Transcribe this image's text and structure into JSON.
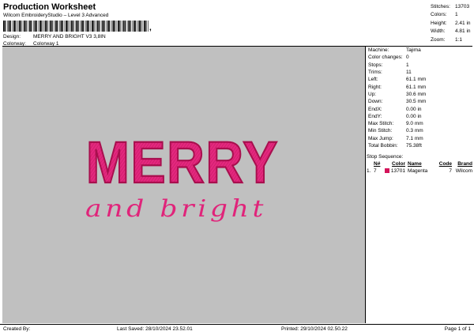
{
  "header": {
    "title": "Production Worksheet",
    "subtitle": "Wilcom EmbroideryStudio – Level 3 Advanced",
    "barcode_suffix": ",",
    "design_label": "Design:",
    "design_value": "MERRY AND BRIGHT V3 3,8IN",
    "colorway_label": "Colorway:",
    "colorway_value": "Colorway 1"
  },
  "top_stats": [
    {
      "label": "Stitches:",
      "value": "13703"
    },
    {
      "label": "Colors:",
      "value": "1"
    },
    {
      "label": "Height:",
      "value": "2.41 in"
    },
    {
      "label": "Width:",
      "value": "4.81 in"
    },
    {
      "label": "Zoom:",
      "value": "1:1"
    }
  ],
  "preview": {
    "line1": "MERRY",
    "line2": "and bright",
    "thread_color": "#e0247a",
    "background": "#c0c0c0"
  },
  "info": [
    {
      "label": "Machine:",
      "value": "Tajima"
    },
    {
      "label": "Color changes:",
      "value": "0"
    },
    {
      "label": "Stops:",
      "value": "1"
    },
    {
      "label": "Trims:",
      "value": "11"
    },
    {
      "label": "Left:",
      "value": "61.1 mm"
    },
    {
      "label": "Right:",
      "value": "61.1 mm"
    },
    {
      "label": "Up:",
      "value": "30.6 mm"
    },
    {
      "label": "Down:",
      "value": "30.5 mm"
    },
    {
      "label": "EndX:",
      "value": "0.00 in"
    },
    {
      "label": "EndY:",
      "value": "0.00 in"
    },
    {
      "label": "Max Stitch:",
      "value": "9.0 mm"
    },
    {
      "label": "Min Stitch:",
      "value": "0.3 mm"
    },
    {
      "label": "Max Jump:",
      "value": "7.1 mm"
    },
    {
      "label": "Total Bobbin:",
      "value": "75.38ft"
    }
  ],
  "stop_sequence": {
    "title": "Stop Sequence:",
    "headers": [
      "N#",
      "",
      "Color",
      "Name",
      "Code",
      "Brand"
    ],
    "rows": [
      {
        "index": "1.",
        "n": "7",
        "swatch": "#d4145a",
        "color": "13701",
        "name": "Magenta",
        "code": "7",
        "brand": "Wilcom"
      }
    ]
  },
  "footer": {
    "created_by": "Created By:",
    "last_saved": "Last Saved: 28/10/2024 23.52.01",
    "printed": "Printed: 29/10/2024 02.50.22",
    "page": "Page 1 of 1"
  }
}
